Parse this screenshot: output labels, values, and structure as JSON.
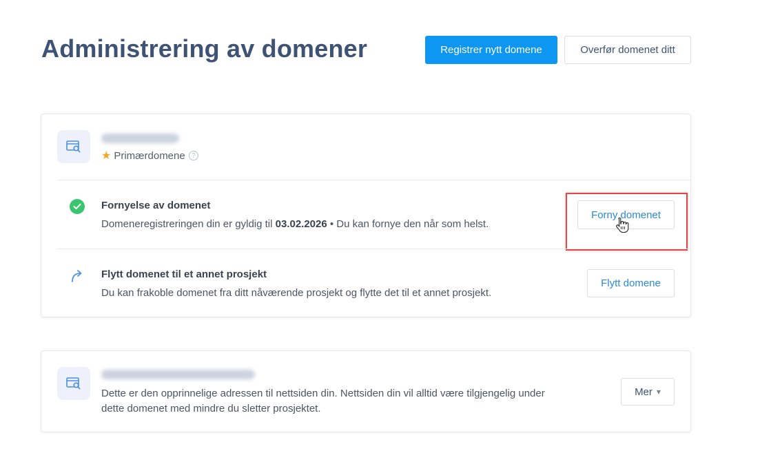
{
  "header": {
    "title": "Administrering av domener",
    "register_button": "Registrer nytt domene",
    "transfer_button": "Overfør domenet ditt"
  },
  "primary_card": {
    "domain_name": "",
    "primary_label": "Primærdomene",
    "help_symbol": "?",
    "renewal": {
      "title": "Fornyelse av domenet",
      "desc_prefix": "Domeneregistreringen din er gyldig til ",
      "date": "03.02.2026",
      "desc_suffix": " • Du kan fornye den når som helst.",
      "button": "Forny domenet"
    },
    "move": {
      "title": "Flytt domenet til et annet prosjekt",
      "desc": "Du kan frakoble domenet fra ditt nåværende prosjekt og flytte det til et annet prosjekt.",
      "button": "Flytt domene"
    }
  },
  "secondary_card": {
    "domain_name": "",
    "desc_line1": "Dette er den opprinnelige adressen til nettsiden din. Nettsiden din vil alltid være tilgjengelig under",
    "desc_line2": "dette domenet med mindre du sletter prosjektet.",
    "more_button": "Mer",
    "more_caret": "▾"
  },
  "colors": {
    "primary": "#0d96f2",
    "title": "#3e5373",
    "success": "#3cc56f",
    "highlight": "#e0474b",
    "star": "#f5a623"
  }
}
